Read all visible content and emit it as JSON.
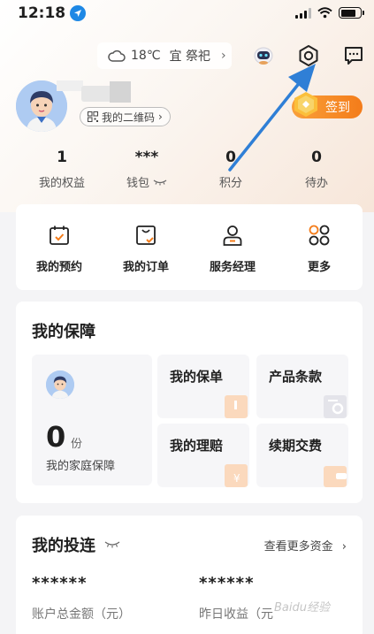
{
  "status_bar": {
    "time": "12:18"
  },
  "weather": {
    "temp": "18℃",
    "almanac": "宜 祭祀"
  },
  "profile": {
    "qr_label": "我的二维码"
  },
  "checkin": {
    "label": "签到"
  },
  "stats": [
    {
      "value": "1",
      "label": "我的权益"
    },
    {
      "value": "***",
      "label": "钱包"
    },
    {
      "value": "0",
      "label": "积分"
    },
    {
      "value": "0",
      "label": "待办"
    }
  ],
  "quick_actions": [
    {
      "label": "我的预约",
      "icon": "calendar-check-icon"
    },
    {
      "label": "我的订单",
      "icon": "order-bag-icon"
    },
    {
      "label": "服务经理",
      "icon": "person-icon"
    },
    {
      "label": "更多",
      "icon": "grid-circles-icon"
    }
  ],
  "coverage": {
    "title": "我的保障",
    "family_count": "0",
    "family_unit": "份",
    "family_label": "我的家庭保障",
    "tiles": [
      {
        "label": "我的保单"
      },
      {
        "label": "产品条款"
      },
      {
        "label": "我的理赔"
      },
      {
        "label": "续期交费"
      }
    ]
  },
  "investment": {
    "title": "我的投连",
    "more_link": "查看更多资金",
    "total_value": "******",
    "total_label": "账户总金额（元）",
    "yesterday_value": "******",
    "yesterday_label": "昨日收益（元"
  },
  "watermark": "Baidu经验",
  "colors": {
    "accent_orange": "#f47c1a",
    "annotation_arrow": "#2f7fd6",
    "brand_blue": "#1e88e5"
  }
}
